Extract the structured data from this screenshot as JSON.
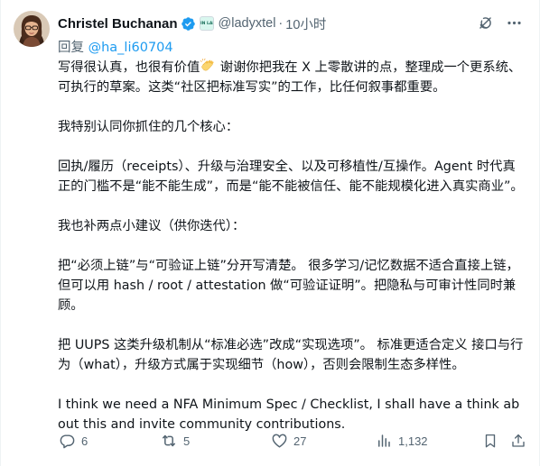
{
  "author": {
    "display_name": "Christel Buchanan",
    "handle": "@ladyxtel",
    "affiliation_badge_text": "DIN LAB",
    "time": "10小时",
    "separator": "·"
  },
  "reply": {
    "prefix": "回复",
    "mention": "@ha_li60704"
  },
  "body": {
    "p1_before_emoji": "写得很认真，也很有价值",
    "p1_after_emoji": " 谢谢你把我在 X 上零散讲的点，整理成一个更系统、可执行的草案。这类“社区把标准写实”的工作，比任何叙事都重要。",
    "p2": "我特别认同你抓住的几个核心：",
    "p3": "回执/履历（receipts）、升级与治理安全、以及可移植性/互操作。Agent 时代真正的门槛不是“能不能生成”，而是“能不能被信任、能不能规模化进入真实商业”。",
    "p4": "我也补两点小建议（供你迭代）：",
    "p5": "把“必须上链”与“可验证上链”分开写清楚。 很多学习/记忆数据不适合直接上链，但可以用 hash / root / attestation 做“可验证证明”。把隐私与可审计性同时兼顾。",
    "p6": "把 UUPS 这类升级机制从“标准必选”改成“实现选项”。 标准更适合定义 接口与行为（what），升级方式属于实现细节（how），否则会限制生态多样性。",
    "p7": "I think we need a NFA Minimum Spec / Checklist, I shall have a think about this and invite community contributions."
  },
  "actions": {
    "replies": "6",
    "retweets": "5",
    "likes": "27",
    "views": "1,132"
  },
  "icons": {
    "verified": "verified-badge-icon",
    "grok": "grok-icon",
    "more": "more-icon",
    "emoji": "clapping-hands-emoji",
    "reply": "reply-icon",
    "retweet": "retweet-icon",
    "like": "heart-icon",
    "views": "views-icon",
    "bookmark": "bookmark-icon",
    "share": "share-icon"
  },
  "colors": {
    "text": "#0f1419",
    "secondary": "#536471",
    "accent": "#1d9bf0"
  }
}
